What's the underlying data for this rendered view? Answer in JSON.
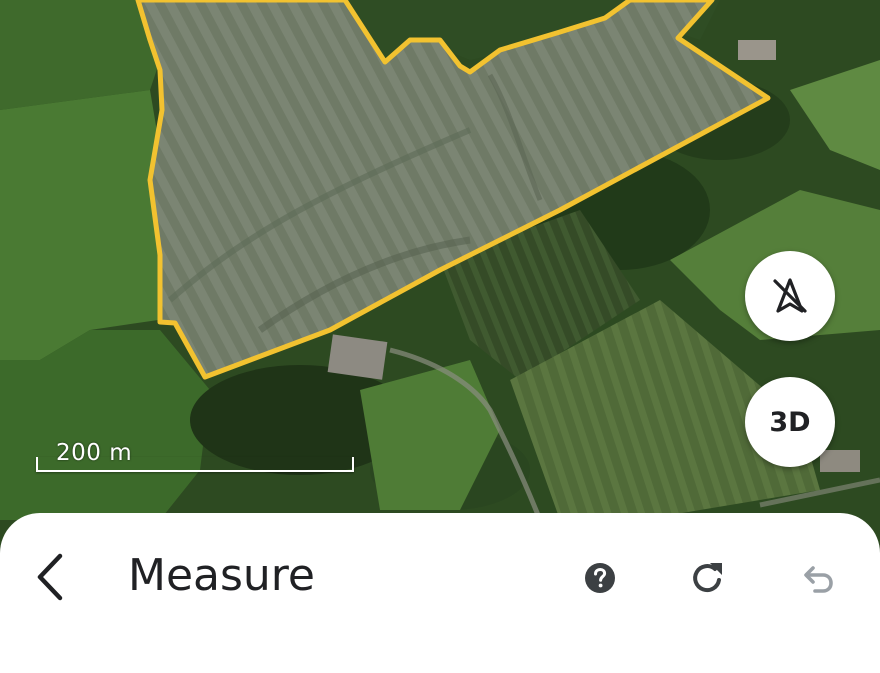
{
  "map": {
    "scale_label": "200 m",
    "buttons": {
      "compass_icon": "compass-off-icon",
      "view_3d_label": "3D"
    },
    "measured_area_outline_color": "#f2c230"
  },
  "sheet": {
    "title": "Measure",
    "back_icon": "chevron-left-icon",
    "help_icon": "help-icon",
    "reset_icon": "refresh-icon",
    "undo_icon": "undo-icon",
    "truncated_text": ""
  },
  "colors": {
    "icon_active": "#3c4043",
    "icon_disabled": "#9aa0a6"
  }
}
